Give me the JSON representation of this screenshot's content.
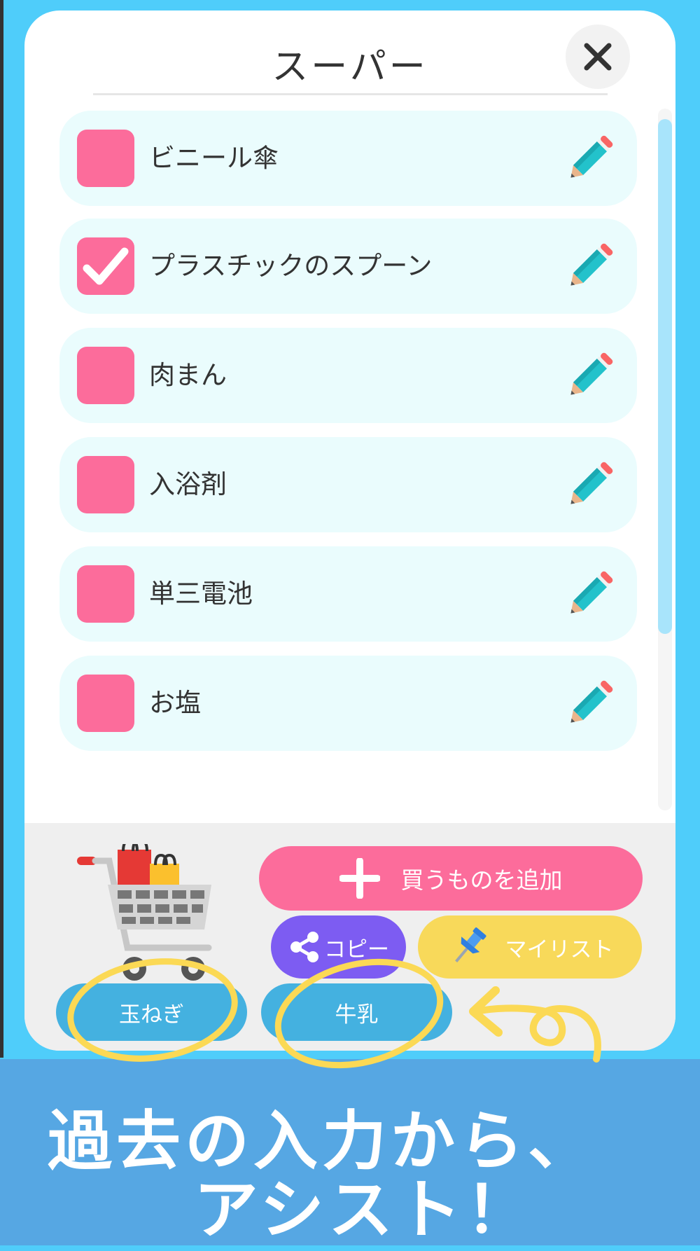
{
  "list": {
    "title": "スーパー",
    "items": [
      {
        "label": "ビニール傘",
        "checked": false
      },
      {
        "label": "プラスチックのスプーン",
        "checked": true
      },
      {
        "label": "肉まん",
        "checked": false
      },
      {
        "label": "入浴剤",
        "checked": false
      },
      {
        "label": "単三電池",
        "checked": false
      },
      {
        "label": "お塩",
        "checked": false
      }
    ]
  },
  "actions": {
    "add_label": "買うものを追加",
    "copy_label": "コピー",
    "mylist_label": "マイリスト"
  },
  "suggestions": [
    "玉ねぎ",
    "牛乳"
  ],
  "caption": {
    "line1": "過去の入力から、",
    "line2": "アシスト！"
  },
  "colors": {
    "background": "#4fcdfa",
    "checkbox": "#fc6c9b",
    "add_button": "#fc6c9b",
    "copy_button": "#7d5cf2",
    "mylist_button": "#f8d95a",
    "suggestion_chip": "#44b1e0",
    "banner": "#56a7e3",
    "highlight_marker": "#fbd955"
  }
}
